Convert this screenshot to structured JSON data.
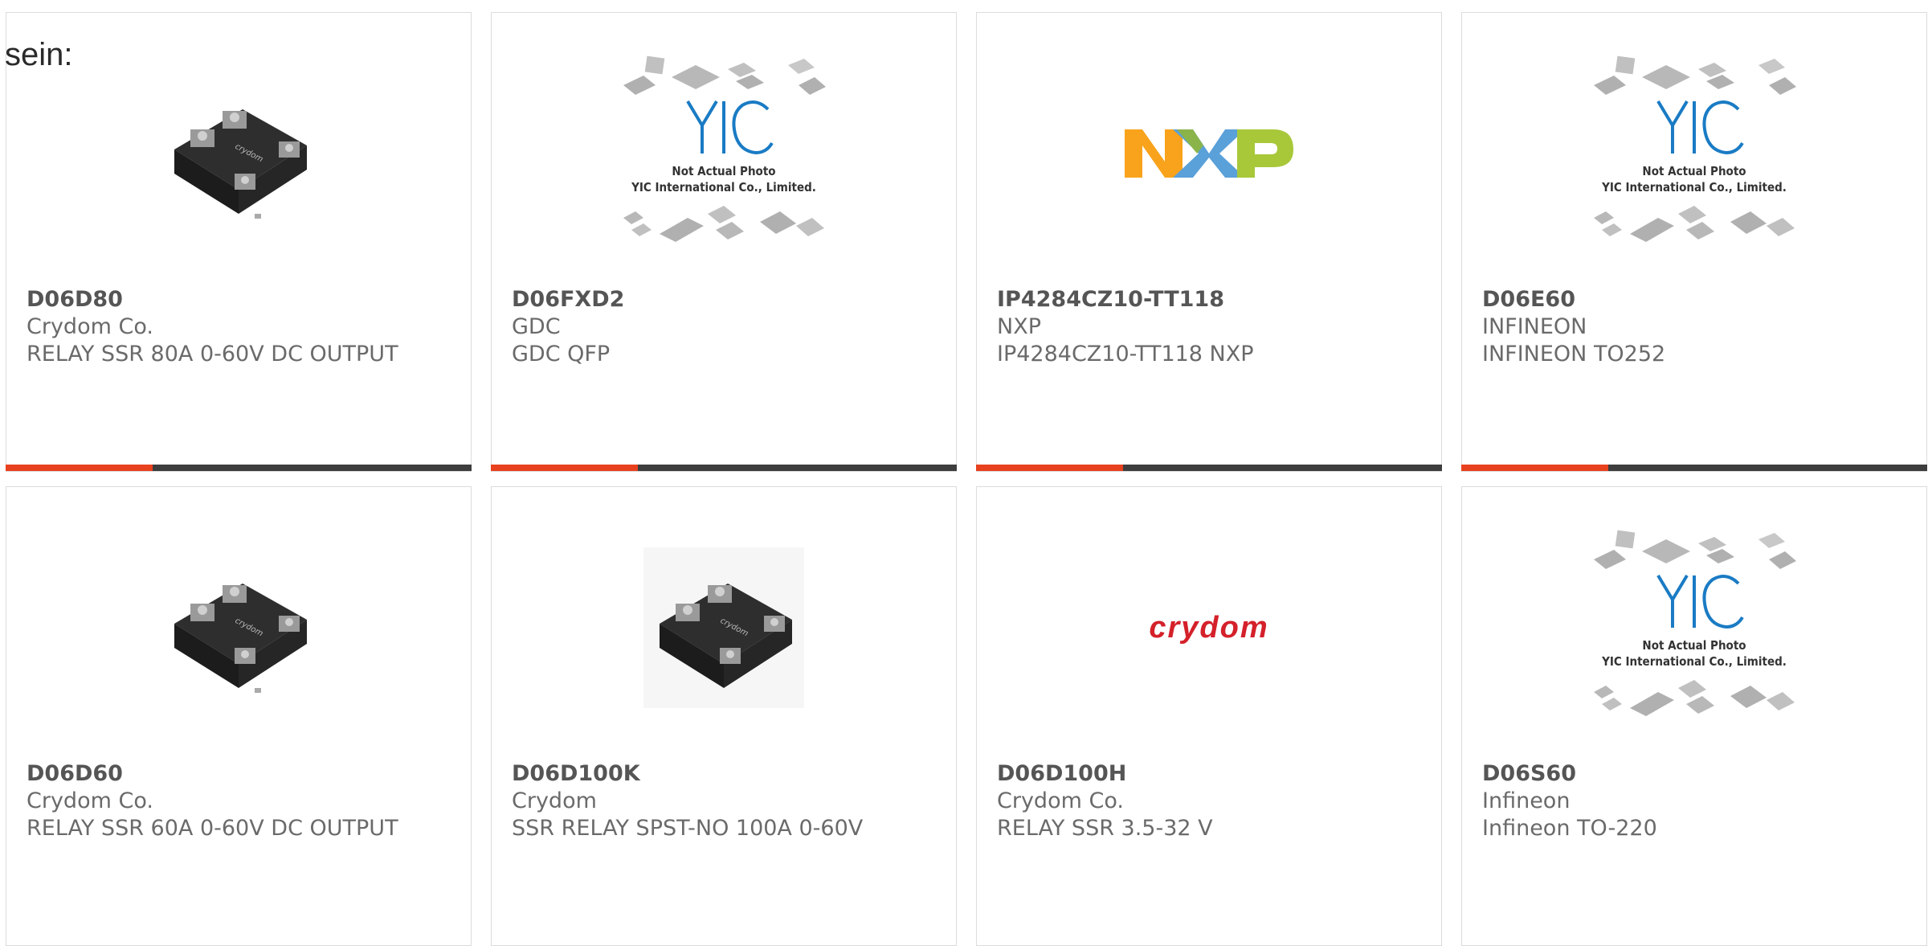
{
  "intro": "sein:",
  "products": [
    {
      "part": "D06D80",
      "manufacturer": "Crydom Co.",
      "description": "RELAY SSR 80A 0-60V DC OUTPUT",
      "image": "relay-image"
    },
    {
      "part": "D06FXD2",
      "manufacturer": "GDC",
      "description": "GDC QFP",
      "image": "yic-placeholder-image"
    },
    {
      "part": "IP4284CZ10-TT118",
      "manufacturer": "NXP",
      "description": "IP4284CZ10-TT118 NXP",
      "image": "nxp-logo"
    },
    {
      "part": "D06E60",
      "manufacturer": "INFINEON",
      "description": "INFINEON TO252",
      "image": "yic-placeholder-image"
    },
    {
      "part": "D06D60",
      "manufacturer": "Crydom Co.",
      "description": "RELAY SSR 60A 0-60V DC OUTPUT",
      "image": "relay-image"
    },
    {
      "part": "D06D100K",
      "manufacturer": "Crydom",
      "description": "SSR RELAY SPST-NO 100A 0-60V",
      "image": "relay-image"
    },
    {
      "part": "D06D100H",
      "manufacturer": "Crydom Co.",
      "description": "RELAY SSR 3.5-32 V",
      "image": "crydom-logo"
    },
    {
      "part": "D06S60",
      "manufacturer": "Infineon",
      "description": "Infineon TO-220",
      "image": "yic-placeholder-image"
    }
  ],
  "placeholder": {
    "line1": "Not Actual Photo",
    "line2": "YIC International Co., Limited.",
    "logo": "YIC"
  },
  "logos": {
    "nxp": "NXP",
    "crydom": "crydom"
  },
  "colors": {
    "accent": "#e8411e",
    "bar": "#3d3d3d",
    "yic_blue": "#1a7bc4",
    "crydom_red": "#d4212a"
  }
}
